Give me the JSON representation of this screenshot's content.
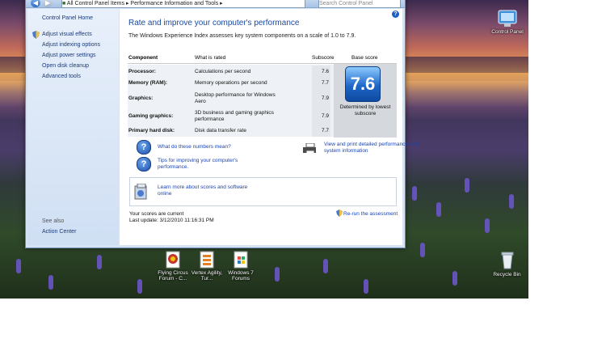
{
  "window": {
    "address_crumbs": "All Control Panel Items  ▸  Performance Information and Tools  ▸",
    "search_placeholder": "Search Control Panel"
  },
  "sidebar": {
    "home": "Control Panel Home",
    "items": [
      {
        "label": "Adjust visual effects"
      },
      {
        "label": "Adjust indexing options"
      },
      {
        "label": "Adjust power settings"
      },
      {
        "label": "Open disk cleanup"
      },
      {
        "label": "Advanced tools"
      }
    ],
    "see_also": "See also",
    "action_center": "Action Center"
  },
  "main": {
    "title": "Rate and improve your computer's performance",
    "subtitle": "The Windows Experience Index assesses key system components on a scale of 1.0 to 7.9.",
    "headers": {
      "component": "Component",
      "what": "What is rated",
      "subscore": "Subscore",
      "base": "Base score"
    },
    "rows": [
      {
        "component": "Processor:",
        "what": "Calculations per second",
        "subscore": "7.6"
      },
      {
        "component": "Memory (RAM):",
        "what": "Memory operations per second",
        "subscore": "7.7"
      },
      {
        "component": "Graphics:",
        "what": "Desktop performance for Windows Aero",
        "subscore": "7.9"
      },
      {
        "component": "Gaming graphics:",
        "what": "3D business and gaming graphics performance",
        "subscore": "7.9"
      },
      {
        "component": "Primary hard disk:",
        "what": "Disk data transfer rate",
        "subscore": "7.7"
      }
    ],
    "base_score": "7.6",
    "base_caption": "Determined by lowest subscore",
    "link_numbers": "What do these numbers mean?",
    "link_tips": "Tips for improving your computer's performance.",
    "link_print": "View and print detailed performance and system information",
    "link_learn": "Learn more about scores and software online",
    "status_current": "Your scores are current",
    "last_update": "Last update: 3/12/2010 11:16:31 PM",
    "rerun": "Re-run the assessment"
  },
  "desktop": {
    "control_panel": "Control Panel",
    "recycle_bin": "Recycle Bin",
    "icon_flying": "Flying Circus Forum - C...",
    "icon_vertex": "Vertex Agility, Tur...",
    "icon_win7": "Windows 7 Forums"
  },
  "colors": {
    "link": "#1a44b8",
    "title": "#1a4aa0",
    "badge": "#1d67c8"
  }
}
